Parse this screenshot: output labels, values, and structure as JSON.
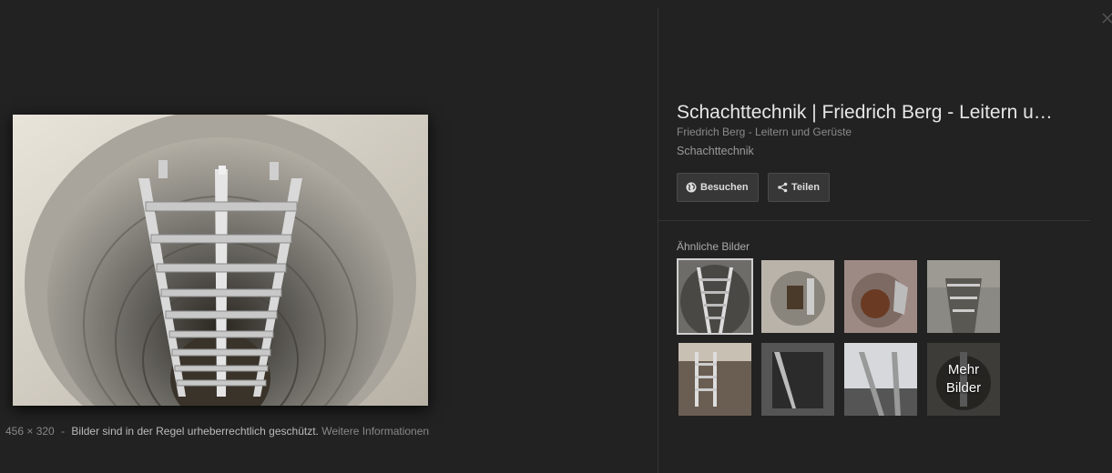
{
  "image": {
    "dimensions": "456 × 320",
    "separator": "-",
    "copyright_notice": "Bilder sind in der Regel urheberrechtlich geschützt.",
    "more_info_link": "Weitere Informationen"
  },
  "result": {
    "title": "Schachttechnik | Friedrich Berg - Leitern u…",
    "source": "Friedrich Berg - Leitern und Gerüste",
    "category": "Schachttechnik"
  },
  "actions": {
    "visit_label": "Besuchen",
    "visit_icon": "globe-icon",
    "share_label": "Teilen",
    "share_icon": "share-icon"
  },
  "similar": {
    "label": "Ähnliche Bilder",
    "more_label_line1": "Mehr",
    "more_label_line2": "Bilder"
  },
  "colors": {
    "background": "#222222",
    "button_bg": "#373737",
    "title_text": "#e6e6e6"
  }
}
